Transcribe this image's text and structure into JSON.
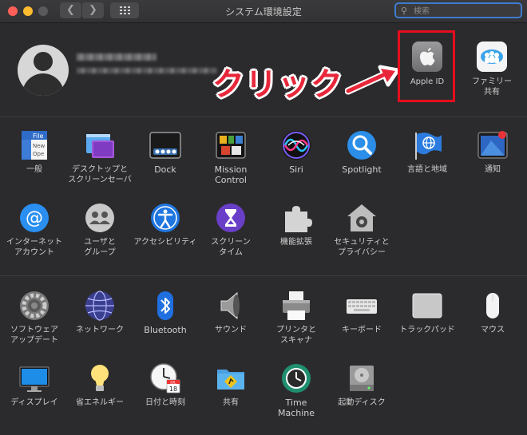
{
  "window": {
    "title": "システム環境設定"
  },
  "search": {
    "placeholder": "検索"
  },
  "annotation": {
    "text": "クリック"
  },
  "top_panes": {
    "apple_id": "Apple ID",
    "family": "ファミリー\n共有"
  },
  "row1": [
    "一般",
    "デスクトップと\nスクリーンセーバ",
    "Dock",
    "Mission\nControl",
    "Siri",
    "Spotlight",
    "言語と地域",
    "通知"
  ],
  "row2": [
    "インターネット\nアカウント",
    "ユーザと\nグループ",
    "アクセシビリティ",
    "スクリーン\nタイム",
    "機能拡張",
    "セキュリティと\nプライバシー"
  ],
  "row3": [
    "ソフトウェア\nアップデート",
    "ネットワーク",
    "Bluetooth",
    "サウンド",
    "プリンタと\nスキャナ",
    "キーボード",
    "トラックパッド",
    "マウス"
  ],
  "row4": [
    "ディスプレイ",
    "省エネルギー",
    "日付と時刻",
    "共有",
    "Time\nMachine",
    "起動ディスク"
  ],
  "icon_text": {
    "general_file": "File",
    "general_new": "New",
    "general_ope": "Ope",
    "calendar_month": "JUL",
    "calendar_day": "18"
  },
  "colors": {
    "highlight": "#e60d1d",
    "annotation": "#e8273a",
    "search_focus": "#3d7ccf"
  }
}
